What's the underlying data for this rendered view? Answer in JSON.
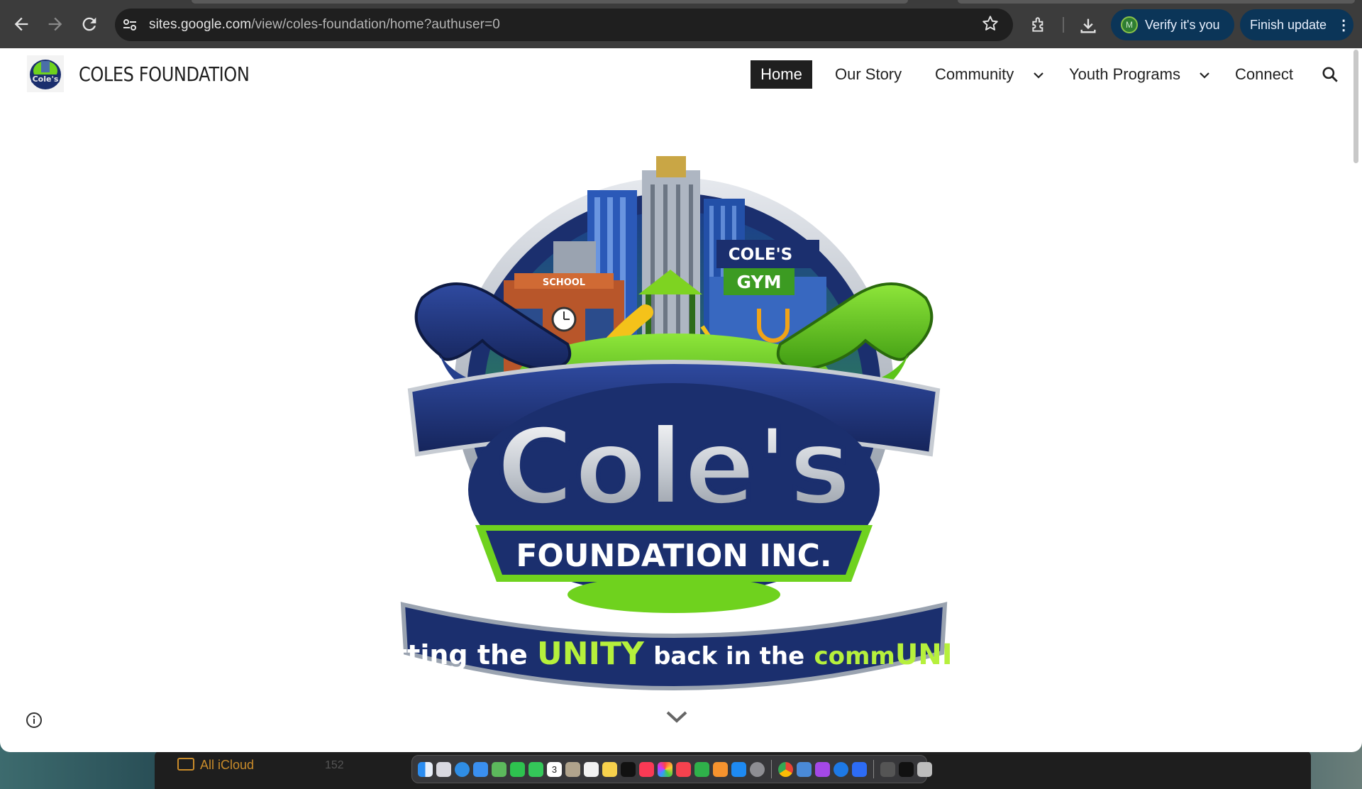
{
  "browser": {
    "url_host": "sites.google.com",
    "url_path": "/view/coles-foundation/home?authuser=0",
    "verify_label": "Verify it's you",
    "verify_avatar": "M",
    "finish_update_label": "Finish update"
  },
  "site": {
    "title": "COLES FOUNDATION",
    "logo_text": "Cole's",
    "nav": {
      "home": "Home",
      "our_story": "Our Story",
      "community": "Community",
      "youth_programs": "Youth Programs",
      "connect": "Connect"
    }
  },
  "hero": {
    "building_school": "SCHOOL",
    "building_gym_1": "COLE'S",
    "building_gym_2": "GYM",
    "name": "Cole's",
    "subtitle": "FOUNDATION INC.",
    "tagline_1": "Putting the",
    "tagline_2": "UNITY",
    "tagline_3": "back in the",
    "tagline_4": "comm",
    "tagline_5": "UNITY"
  },
  "desktop": {
    "finder_label": "All iCloud",
    "finder_count": "152",
    "dock_badge": "3"
  },
  "colors": {
    "navy": "#1b2f6e",
    "green": "#6fd21e",
    "toolbar": "#3c3c3c",
    "chip": "#0b3558"
  },
  "icons": [
    "back-icon",
    "forward-icon",
    "reload-icon",
    "site-info-icon",
    "star-icon",
    "extensions-icon",
    "download-icon",
    "kebab-icon",
    "search-icon",
    "chevron-down-icon",
    "info-icon"
  ]
}
